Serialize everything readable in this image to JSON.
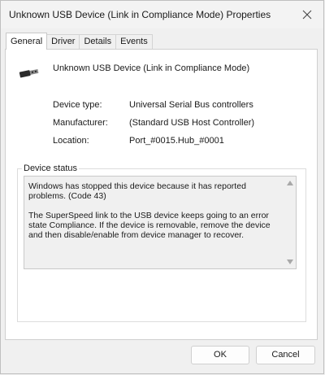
{
  "window": {
    "title": "Unknown USB Device (Link in Compliance Mode) Properties"
  },
  "tabs": [
    {
      "label": "General",
      "active": true
    },
    {
      "label": "Driver",
      "active": false
    },
    {
      "label": "Details",
      "active": false
    },
    {
      "label": "Events",
      "active": false
    }
  ],
  "device": {
    "icon": "usb-plug-icon",
    "name": "Unknown USB Device (Link in Compliance Mode)",
    "properties": [
      {
        "label": "Device type:",
        "value": "Universal Serial Bus controllers"
      },
      {
        "label": "Manufacturer:",
        "value": "(Standard USB Host Controller)"
      },
      {
        "label": "Location:",
        "value": "Port_#0015.Hub_#0001"
      }
    ]
  },
  "status": {
    "title": "Device status",
    "text": "Windows has stopped this device because it has reported problems. (Code 43)\n\nThe SuperSpeed link to the USB device keeps going to an error state Compliance. If the device is removable, remove the device and then disable/enable from device manager to recover."
  },
  "buttons": {
    "ok": "OK",
    "cancel": "Cancel"
  }
}
